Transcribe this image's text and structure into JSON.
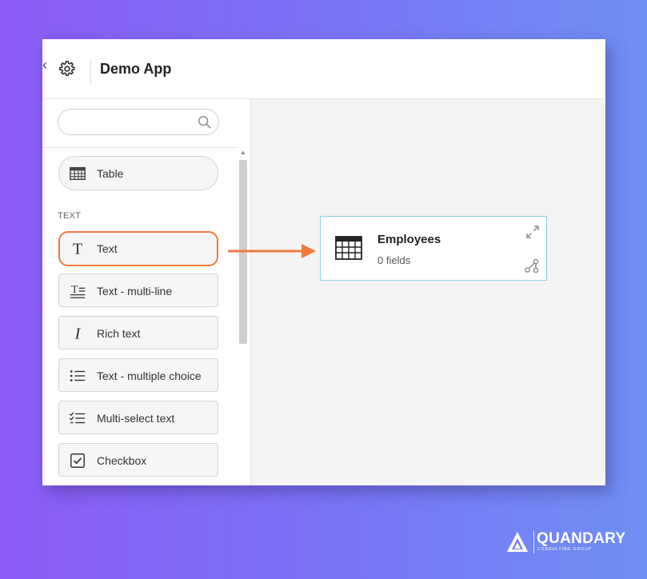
{
  "header": {
    "app_title": "Demo App",
    "settings_icon": "gear-icon"
  },
  "sidebar": {
    "search": {
      "value": "",
      "placeholder": "",
      "icon": "search-icon"
    },
    "items": [
      {
        "label": "Table",
        "icon": "table-grid-icon"
      },
      {
        "label": "Text",
        "icon": "text-t-icon",
        "highlighted": true
      },
      {
        "label": "Text - multi-line",
        "icon": "text-multiline-icon"
      },
      {
        "label": "Rich text",
        "icon": "italic-i-icon"
      },
      {
        "label": "Text - multiple choice",
        "icon": "bullet-list-icon"
      },
      {
        "label": "Multi-select text",
        "icon": "checklist-icon"
      },
      {
        "label": "Checkbox",
        "icon": "checkbox-icon"
      }
    ],
    "section_label": "TEXT"
  },
  "canvas": {
    "entity": {
      "name": "Employees",
      "subtitle": "0 fields",
      "icon": "table-grid-icon"
    }
  },
  "brand": {
    "name": "QUANDARY",
    "tagline": "CONSULTING GROUP"
  },
  "colors": {
    "highlight": "#ef7a3c",
    "card_border": "#8fd0e4",
    "background_start": "#8b5cf6",
    "background_end": "#6f8ff3"
  }
}
